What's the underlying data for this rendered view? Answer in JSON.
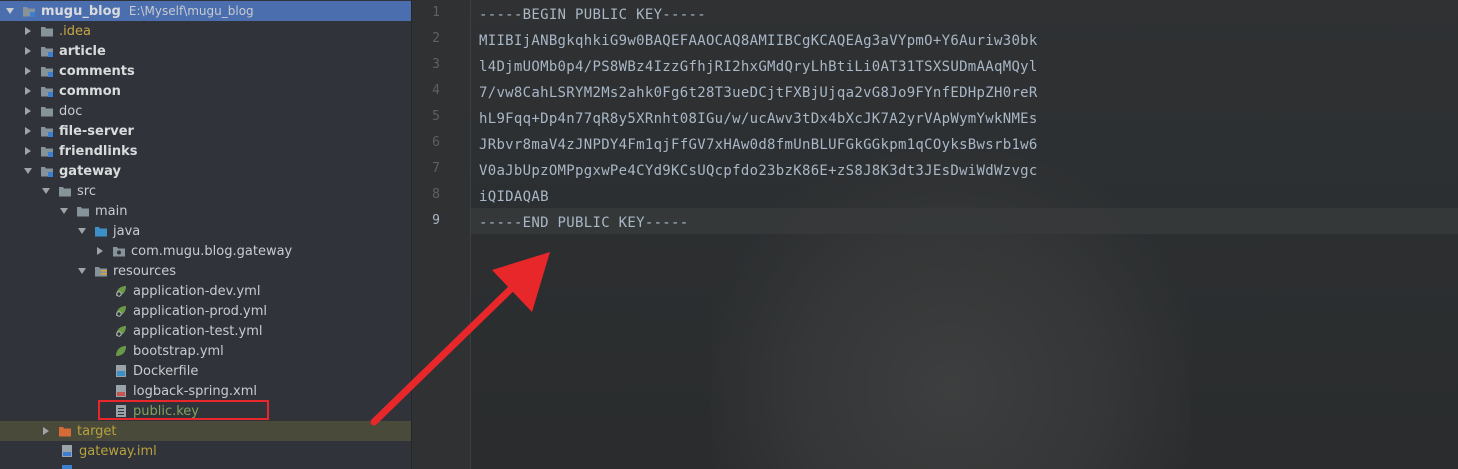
{
  "project_tree": {
    "root": {
      "name": "mugu_blog",
      "path": "E:\\Myself\\mugu_blog"
    },
    "items": [
      {
        "label": ".idea"
      },
      {
        "label": "article"
      },
      {
        "label": "comments"
      },
      {
        "label": "common"
      },
      {
        "label": "doc"
      },
      {
        "label": "file-server"
      },
      {
        "label": "friendlinks"
      },
      {
        "label": "gateway"
      },
      {
        "label": "src"
      },
      {
        "label": "main"
      },
      {
        "label": "java"
      },
      {
        "label": "com.mugu.blog.gateway"
      },
      {
        "label": "resources"
      },
      {
        "label": "application-dev.yml"
      },
      {
        "label": "application-prod.yml"
      },
      {
        "label": "application-test.yml"
      },
      {
        "label": "bootstrap.yml"
      },
      {
        "label": "Dockerfile"
      },
      {
        "label": "logback-spring.xml"
      },
      {
        "label": "public.key"
      },
      {
        "label": "target"
      },
      {
        "label": "gateway.iml"
      }
    ]
  },
  "editor": {
    "line_numbers": [
      "1",
      "2",
      "3",
      "4",
      "5",
      "6",
      "7",
      "8",
      "9"
    ],
    "current_line": 9,
    "lines": [
      "-----BEGIN PUBLIC KEY-----",
      "MIIBIjANBgkqhkiG9w0BAQEFAAOCAQ8AMIIBCgKCAQEAg3aVYpmO+Y6Auriw30bk",
      "l4DjmUOMb0p4/PS8WBz4IzzGfhjRI2hxGMdQryLhBtiLi0AT31TSXSUDmAAqMQyl",
      "7/vw8CahLSRYM2Ms2ahk0Fg6t28T3ueDCjtFXBjUjqa2vG8Jo9FYnfEDHpZH0reR",
      "hL9Fqq+Dp4n77qR8y5XRnht08IGu/w/ucAwv3tDx4bXcJK7A2yrVApWymYwkNMEs",
      "JRbvr8maV4zJNPDY4Fm1qjFfGV7xHAw0d8fmUnBLUFGkGGkpm1qCOyksBwsrb1w6",
      "V0aJbUpzOMPpgxwPe4CYd9KCsUQcpfdo23bzK86E+zS8J8K3dt3JEsDwiWdWzvgc",
      "iQIDAQAB",
      "-----END PUBLIC KEY-----"
    ]
  },
  "colors": {
    "selection": "#4b6eaf",
    "annotation_red": "#e8272b",
    "folder_blue": "#87939a",
    "spring_green": "#6a9a47"
  }
}
